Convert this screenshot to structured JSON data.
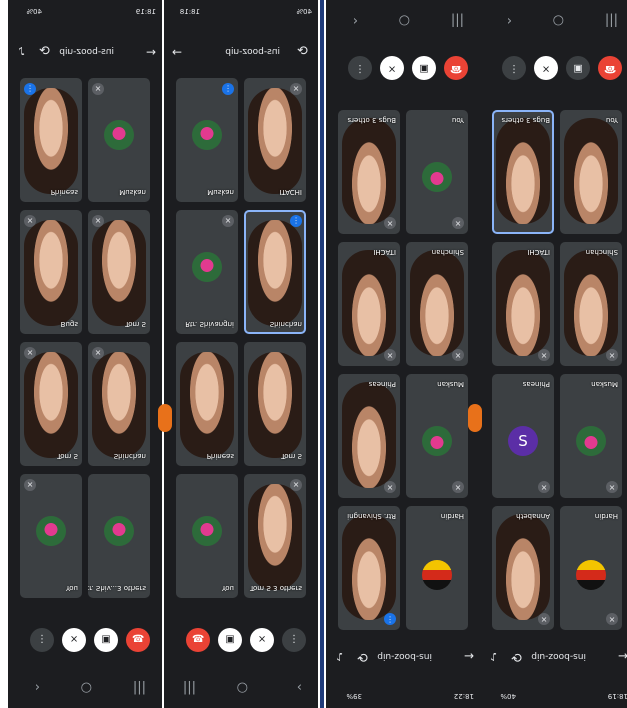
{
  "meeting_code": "ins-booz-uip",
  "panels": [
    {
      "status": {
        "time": "18:19",
        "battery": "40%"
      },
      "tiles": [
        {
          "label": "Muskan",
          "type": "avatar"
        },
        {
          "label": "Phineas",
          "type": "video"
        },
        {
          "label": "Tom S",
          "type": "video"
        },
        {
          "label": "Bugs",
          "type": "video"
        },
        {
          "label": "Shinchan",
          "type": "video"
        },
        {
          "label": "Tom S",
          "type": "video"
        },
        {
          "label": "Rtr. Shiv...3 others",
          "type": "avatar"
        },
        {
          "label": "You",
          "type": "avatar"
        }
      ]
    },
    {
      "status": {
        "time": "18:18",
        "battery": "40%"
      },
      "tiles": [
        {
          "label": "Muskan",
          "type": "avatar"
        },
        {
          "label": "ITACHI",
          "type": "video"
        },
        {
          "label": "Rtr. Shivangni",
          "type": "avatar"
        },
        {
          "label": "Shinchan",
          "type": "video"
        },
        {
          "label": "Phineas",
          "type": "video"
        },
        {
          "label": "Tom S",
          "type": "video"
        },
        {
          "label": "You",
          "type": "avatar"
        },
        {
          "label": "Tom S 3 others",
          "type": "video"
        }
      ]
    },
    {
      "status": {
        "time": "18:22",
        "battery": "39%"
      },
      "tiles": [
        {
          "label": "Rtr. Shivangni",
          "type": "video"
        },
        {
          "label": "Hardin",
          "type": "flag"
        },
        {
          "label": "Phineas",
          "type": "video"
        },
        {
          "label": "Muskan",
          "type": "avatar"
        },
        {
          "label": "ITACHI",
          "type": "video"
        },
        {
          "label": "Shinchan",
          "type": "video"
        },
        {
          "label": "Bugs 3 others",
          "type": "video"
        },
        {
          "label": "You",
          "type": "avatar"
        }
      ]
    },
    {
      "status": {
        "time": "18:19",
        "battery": "40%"
      },
      "tiles": [
        {
          "label": "Annabeth",
          "type": "video"
        },
        {
          "label": "Hardin",
          "type": "flag"
        },
        {
          "label": "Phineas",
          "type": "avatar_s"
        },
        {
          "label": "Muskan",
          "type": "avatar"
        },
        {
          "label": "ITACHI",
          "type": "video"
        },
        {
          "label": "Shinchan",
          "type": "video"
        },
        {
          "label": "Bugs 3 others",
          "type": "video"
        },
        {
          "label": "You",
          "type": "video"
        }
      ]
    }
  ],
  "avatar_letter": "S",
  "icons": {
    "back": "back-arrow-icon",
    "switch": "camera-switch-icon",
    "speaker": "speaker-icon",
    "mic": "mic-off-icon",
    "cam": "camera-off-icon",
    "end": "end-call-icon",
    "more": "more-icon"
  },
  "colors": {
    "accent": "#1a73e8",
    "end": "#ea4335",
    "bg": "#1c1d20",
    "tile": "#3c4043"
  }
}
